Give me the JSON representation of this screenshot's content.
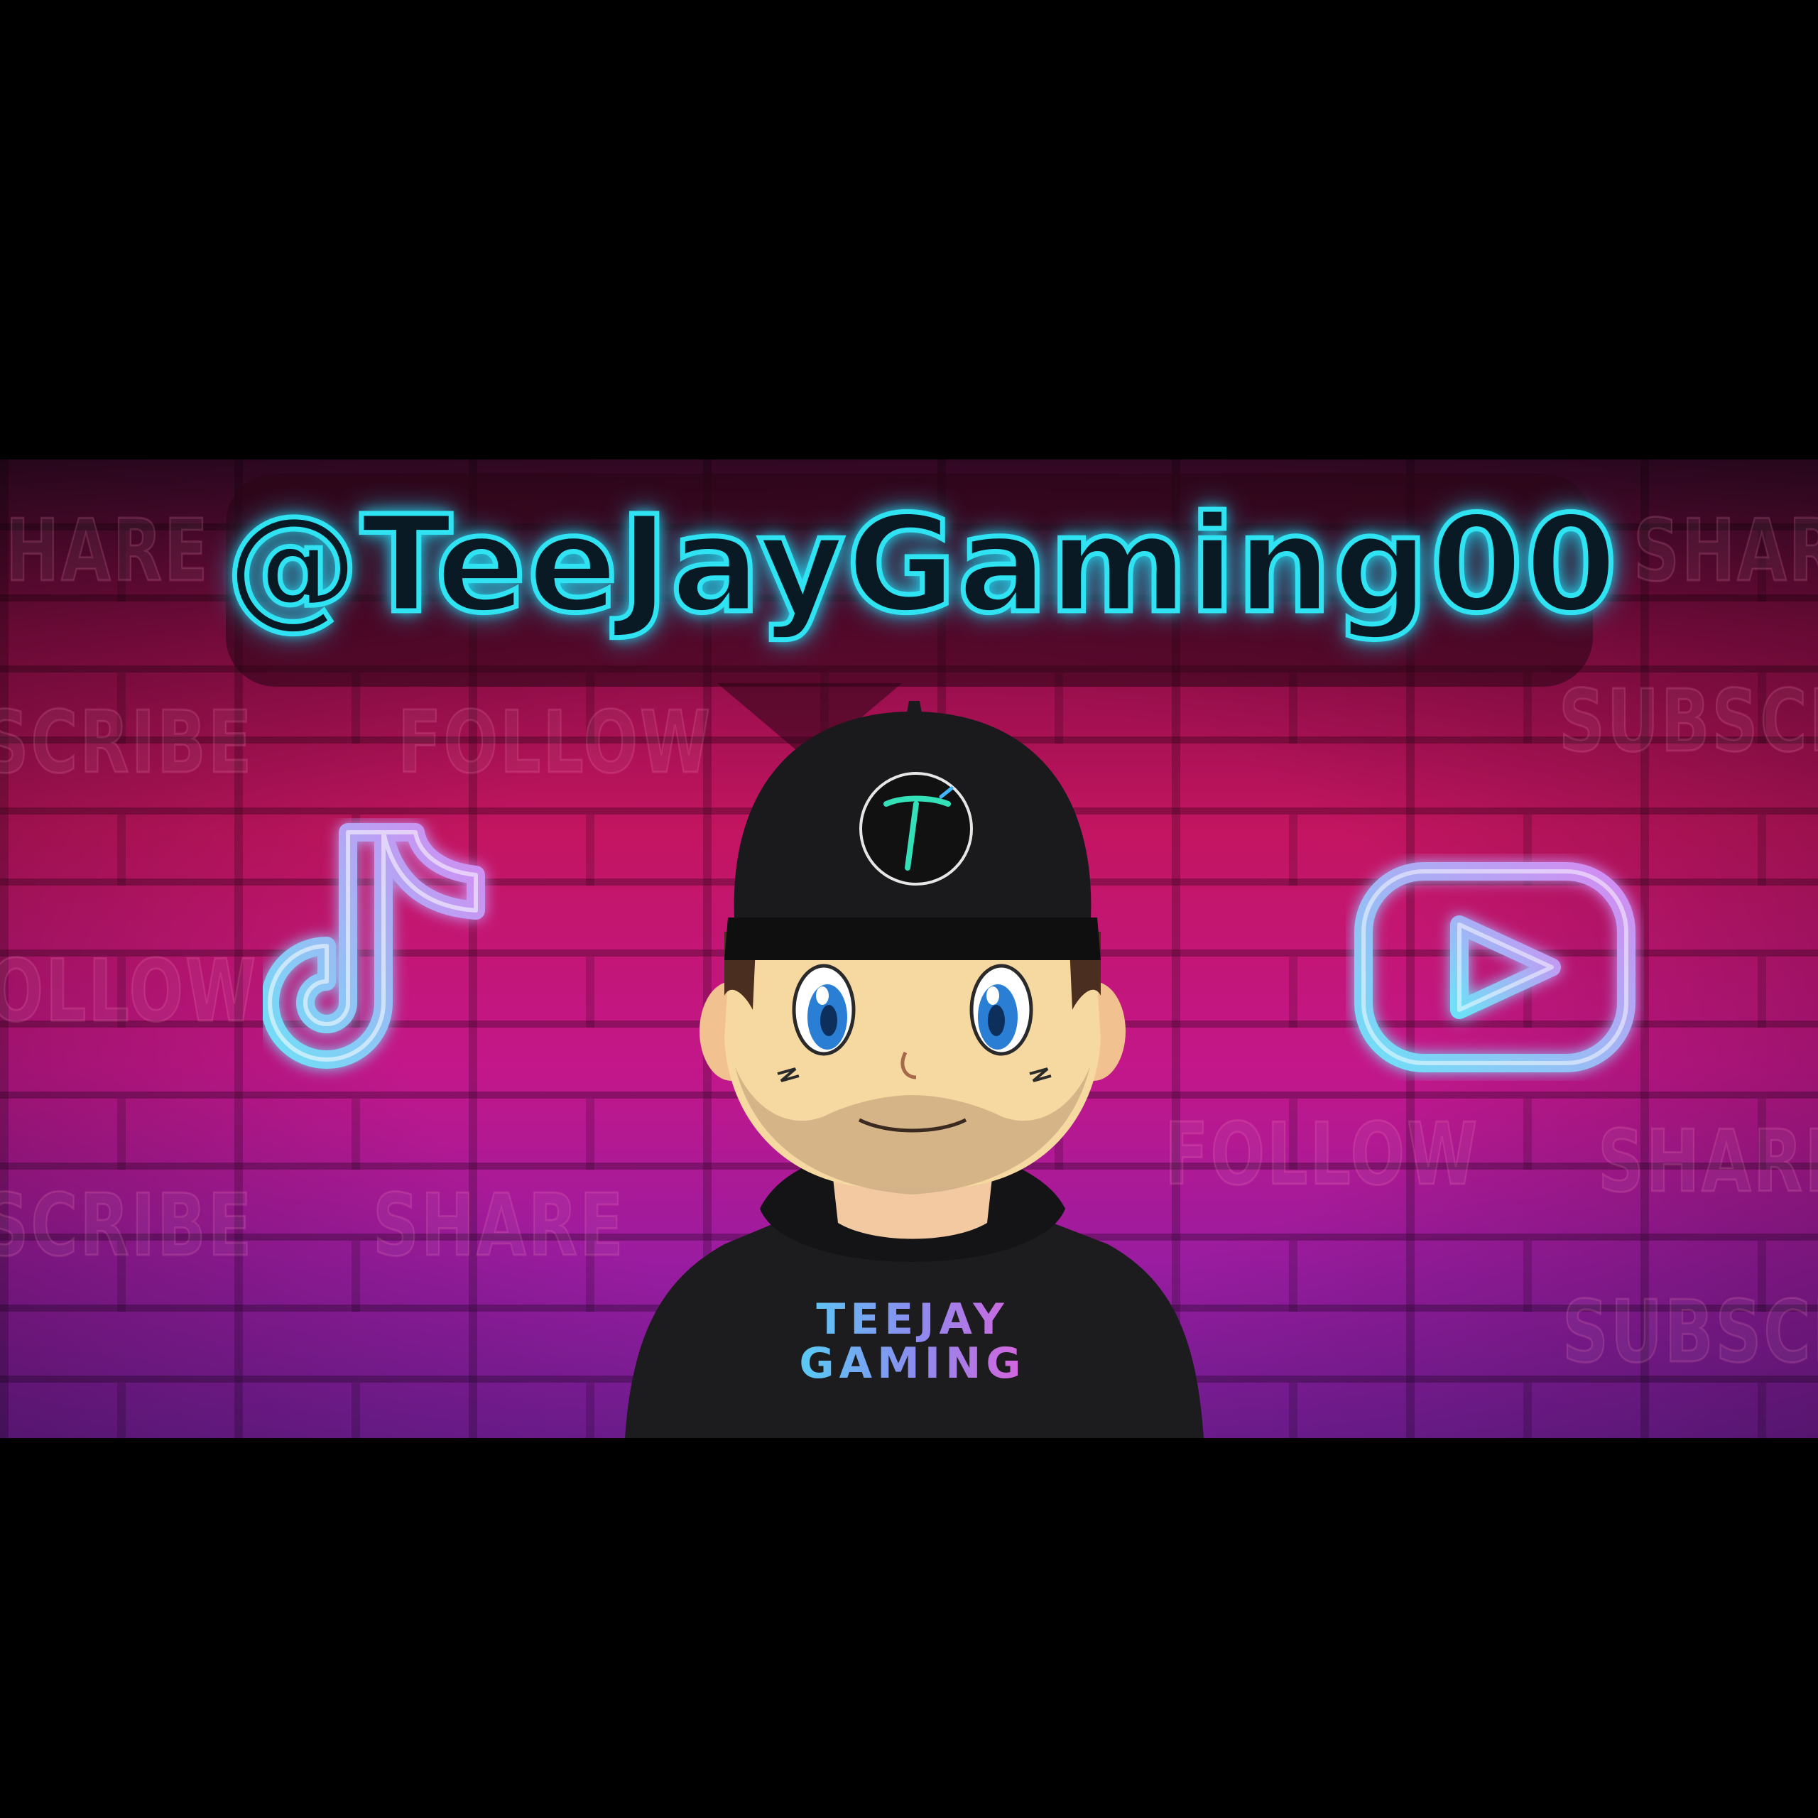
{
  "banner": {
    "handle": "@TeeJayGaming00",
    "hoodie_line_1": "TEEJAY",
    "hoodie_line_2": "GAMING",
    "background_words": {
      "share_top_left": "SHARE",
      "share_top_right": "SHARE",
      "subscribe_left_1": "SUBSCRIBE",
      "follow_center_left": "FOLLOW",
      "subscribe_right_1": "SUBSCRIBE",
      "follow_left": "FOLLOW",
      "subscribe_left_2": "SUBSCRIBE",
      "share_bottom_left": "SHARE",
      "follow_bottom_right": "FOLLOW",
      "share_bottom_right": "SHARE",
      "subscribe_right_2": "SUBSCRIBE"
    },
    "icons": [
      "tiktok-icon",
      "youtube-icon"
    ],
    "colors": {
      "handle_glow": "#2fe3f2",
      "icon_gradient_start": "#6ee0f7",
      "icon_gradient_end": "#d58af2",
      "background_top": "#8d0d47",
      "background_bottom": "#7a1f9f"
    }
  }
}
